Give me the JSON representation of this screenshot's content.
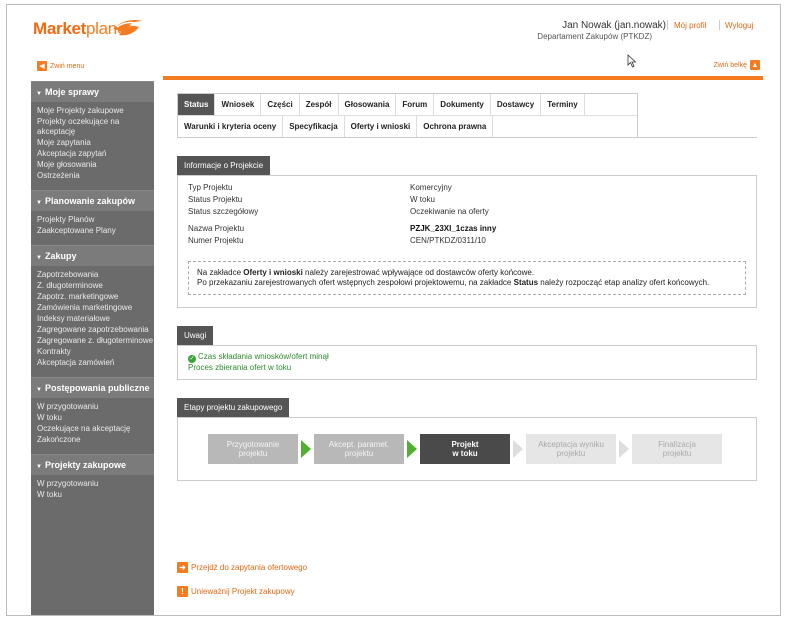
{
  "header": {
    "logo_main": "Market",
    "logo_planet": "planet",
    "user_name": "Jan Nowak (jan.nowak)",
    "department": "Departament Zakupów (PTKDZ)",
    "my_profile": "Mój profil",
    "logout": "Wyloguj"
  },
  "controls": {
    "collapse_menu": "Zwiń menu",
    "collapse_bar": "Zwiń belkę"
  },
  "sidebar": {
    "sections": [
      {
        "title": "Moje sprawy",
        "items": [
          "Moje Projekty zakupowe",
          "Projekty oczekujące na akceptację",
          "Moje zapytania",
          "Akceptacja zapytań",
          "Moje głosowania",
          "Ostrzeżenia"
        ]
      },
      {
        "title": "Planowanie zakupów",
        "items": [
          "Projekty Planów",
          "Zaakceptowane Plany"
        ]
      },
      {
        "title": "Zakupy",
        "items": [
          "Zapotrzebowania",
          "Z. długoterminowe",
          "Zapotrz. marketingowe",
          "Zamówienia marketingowe",
          "Indeksy materiałowe",
          "Zagregowane zapotrzebowania",
          "Zagregowane z. długoterminowe",
          "Kontrakty",
          "Akceptacja zamówień"
        ]
      },
      {
        "title": "Postępowania publiczne",
        "items": [
          "W przygotowaniu",
          "W toku",
          "Oczekujące na akceptację",
          "Zakończone"
        ]
      },
      {
        "title": "Projekty zakupowe",
        "items": [
          "W przygotowaniu",
          "W toku"
        ]
      }
    ]
  },
  "tabs": {
    "row1": [
      "Status",
      "Wniosek",
      "Części",
      "Zespół",
      "Głosowania",
      "Forum",
      "Dokumenty",
      "Dostawcy",
      "Terminy"
    ],
    "row2": [
      "Warunki i kryteria oceny",
      "Specyfikacja",
      "Oferty i wnioski",
      "Ochrona prawna"
    ],
    "active": "Status"
  },
  "project_info": {
    "heading": "Informacje o Projekcie",
    "rows": [
      {
        "label": "Typ Projektu",
        "value": "Komercyjny"
      },
      {
        "label": "Status Projektu",
        "value": "W toku"
      },
      {
        "label": "Status szczegółowy",
        "value": "Oczekiwanie na oferty"
      },
      {
        "label": "Nazwa Projektu",
        "value": "PZJK_23XI_1czas inny"
      },
      {
        "label": "Numer Projektu",
        "value": "CEN/PTKDZ/0311/10"
      }
    ],
    "note": {
      "p1_before": "Na zakładce ",
      "p1_bold": "Oferty i wnioski",
      "p1_after": " należy zarejestrować wpływające od dostawców oferty końcowe.",
      "p2_before": "Po przekazaniu zarejestrowanych ofert wstępnych zespołowi projektowemu, na zakładce ",
      "p2_bold": "Status",
      "p2_after": " należy rozpocząć etap analizy ofert końcowych."
    }
  },
  "remarks": {
    "heading": "Uwagi",
    "line1": "Czas składania wniosków/ofert minął",
    "line2": "Proces zbierania ofert w toku"
  },
  "stages": {
    "heading": "Etapy projektu zakupowego",
    "items": [
      {
        "l1": "Przygotowanie",
        "l2": "projektu"
      },
      {
        "l1": "Akcept. paramet.",
        "l2": "projektu"
      },
      {
        "l1": "Projekt",
        "l2": "w toku"
      },
      {
        "l1": "Akceptacja wyniku",
        "l2": "projektu"
      },
      {
        "l1": "Finalizacja",
        "l2": "projektu"
      }
    ]
  },
  "actions": {
    "goto_inquiry": "Przejdź do zapytania ofertowego",
    "cancel_project": "Unieważnij Projekt zakupowy"
  },
  "colors": {
    "accent": "#f37c20",
    "sidebar": "#6b6b6b",
    "active_tab": "#555555",
    "success": "#3aa53a"
  }
}
